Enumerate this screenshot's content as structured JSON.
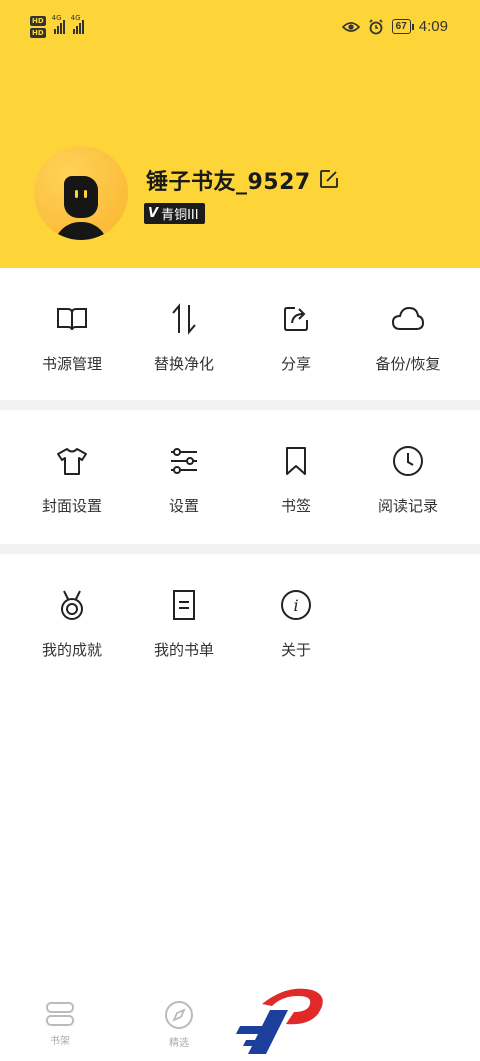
{
  "status_bar": {
    "hd1": "HD",
    "hd2": "HD",
    "net1": "4G",
    "net2": "4G",
    "battery": "67",
    "time": "4:09",
    "icons": [
      "hd-icon",
      "signal-icon",
      "eye-icon",
      "alarm-icon",
      "battery-icon"
    ]
  },
  "profile": {
    "username": "锤子书友_9527",
    "level": "青铜III",
    "level_prefix": "V",
    "header_color": "#fdd539"
  },
  "menu_sections": [
    {
      "items": [
        {
          "label": "书源管理",
          "icon": "book-icon"
        },
        {
          "label": "替换净化",
          "icon": "swap-arrows-icon"
        },
        {
          "label": "分享",
          "icon": "share-icon"
        },
        {
          "label": "备份/恢复",
          "icon": "cloud-icon"
        }
      ]
    },
    {
      "items": [
        {
          "label": "封面设置",
          "icon": "tshirt-icon"
        },
        {
          "label": "设置",
          "icon": "sliders-icon"
        },
        {
          "label": "书签",
          "icon": "bookmark-icon"
        },
        {
          "label": "阅读记录",
          "icon": "clock-icon"
        }
      ]
    },
    {
      "items": [
        {
          "label": "我的成就",
          "icon": "medal-icon"
        },
        {
          "label": "我的书单",
          "icon": "booklist-icon"
        },
        {
          "label": "关于",
          "icon": "info-icon"
        }
      ]
    }
  ],
  "bottom_nav": {
    "items": [
      {
        "label": "书架",
        "icon": "bookshelf-icon"
      },
      {
        "label": "精选",
        "icon": "compass-icon"
      }
    ]
  }
}
